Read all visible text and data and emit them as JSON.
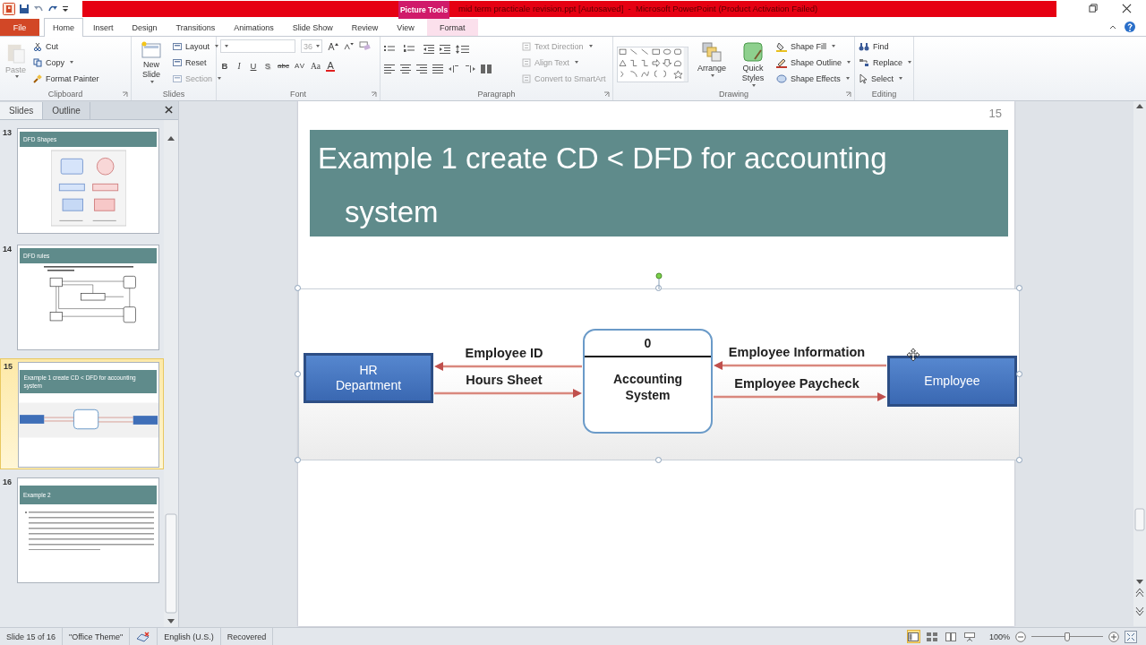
{
  "window": {
    "title": "mid term practicale revision.ppt [Autosaved]  -  Microsoft PowerPoint (Product Activation Failed)",
    "context_tab": "Picture Tools"
  },
  "tabs": [
    {
      "label": "File",
      "kind": "file",
      "selected": false
    },
    {
      "label": "Home",
      "kind": "main",
      "selected": true
    },
    {
      "label": "Insert",
      "kind": "main",
      "selected": false
    },
    {
      "label": "Design",
      "kind": "main",
      "selected": false
    },
    {
      "label": "Transitions",
      "kind": "main",
      "selected": false
    },
    {
      "label": "Animations",
      "kind": "main",
      "selected": false
    },
    {
      "label": "Slide Show",
      "kind": "main",
      "selected": false
    },
    {
      "label": "Review",
      "kind": "main",
      "selected": false
    },
    {
      "label": "View",
      "kind": "main",
      "selected": false
    },
    {
      "label": "Format",
      "kind": "context",
      "selected": false
    }
  ],
  "ribbon": [
    {
      "kind": "clipboard",
      "label": "Clipboard",
      "large": {
        "label": "Paste",
        "disabled": true
      },
      "small": [
        {
          "label": "Cut",
          "disabled": false
        },
        {
          "label": "Copy",
          "disabled": false
        },
        {
          "label": "Format Painter",
          "disabled": false
        }
      ]
    },
    {
      "kind": "slides",
      "label": "Slides",
      "large": {
        "label": "New Slide",
        "disabled": false
      },
      "small": [
        {
          "label": "Layout",
          "disabled": false
        },
        {
          "label": "Reset",
          "disabled": false
        },
        {
          "label": "Section",
          "disabled": true
        }
      ]
    },
    {
      "kind": "font",
      "label": "Font",
      "combo_text": "36",
      "format": [
        "B",
        "I",
        "U",
        "S",
        "abc",
        "AV",
        "Aa",
        "A"
      ]
    },
    {
      "kind": "paragraph",
      "label": "Paragraph",
      "small": [
        {
          "label": "Text Direction",
          "disabled": true
        },
        {
          "label": "Align Text",
          "disabled": true
        },
        {
          "label": "Convert to SmartArt",
          "disabled": true
        }
      ]
    },
    {
      "kind": "drawing",
      "label": "Drawing",
      "large": [
        {
          "label": "Arrange"
        },
        {
          "label": "Quick Styles"
        }
      ],
      "small": [
        {
          "label": "Shape Fill",
          "disabled": false
        },
        {
          "label": "Shape Outline",
          "disabled": false
        },
        {
          "label": "Shape Effects",
          "disabled": false
        }
      ]
    },
    {
      "kind": "editing",
      "label": "Editing",
      "small": [
        {
          "label": "Find",
          "disabled": false
        },
        {
          "label": "Replace",
          "disabled": false
        },
        {
          "label": "Select",
          "disabled": false
        }
      ]
    }
  ],
  "pane_tabs": [
    {
      "label": "Slides",
      "selected": true
    },
    {
      "label": "Outline",
      "selected": false
    }
  ],
  "thumbnails": [
    {
      "number": "13",
      "title": "DFD Shapes",
      "kind": "shapes",
      "selected": false
    },
    {
      "number": "14",
      "title": "DFD rules",
      "kind": "rules",
      "selected": false
    },
    {
      "number": "15",
      "title": "Example 1 create CD < DFD for accounting system",
      "kind": "diagram",
      "selected": true
    },
    {
      "number": "16",
      "title": "Example 2",
      "kind": "text",
      "selected": false
    }
  ],
  "slide": {
    "number": "15",
    "title": "Example 1 create CD < DFD for accounting system",
    "diagram": {
      "process_id": "0",
      "process": "Accounting System",
      "left_entity": "HR Department",
      "right_entity": "Employee",
      "left_flows": [
        {
          "label": "Employee ID",
          "inbound": false
        },
        {
          "label": "Hours Sheet",
          "inbound": true
        }
      ],
      "right_flows": [
        {
          "label": "Employee Information",
          "inbound": true
        },
        {
          "label": "Employee Paycheck",
          "inbound": false
        }
      ]
    }
  },
  "status_bar": {
    "slide": "Slide 15 of 16",
    "theme": "\"Office Theme\"",
    "language": "English (U.S.)",
    "state": "Recovered",
    "zoom": "100%",
    "level": 0.5,
    "views": [
      {
        "kind": "normal",
        "selected": true
      },
      {
        "kind": "sorter",
        "selected": false
      },
      {
        "kind": "reading",
        "selected": false
      },
      {
        "kind": "show",
        "selected": false
      }
    ]
  }
}
